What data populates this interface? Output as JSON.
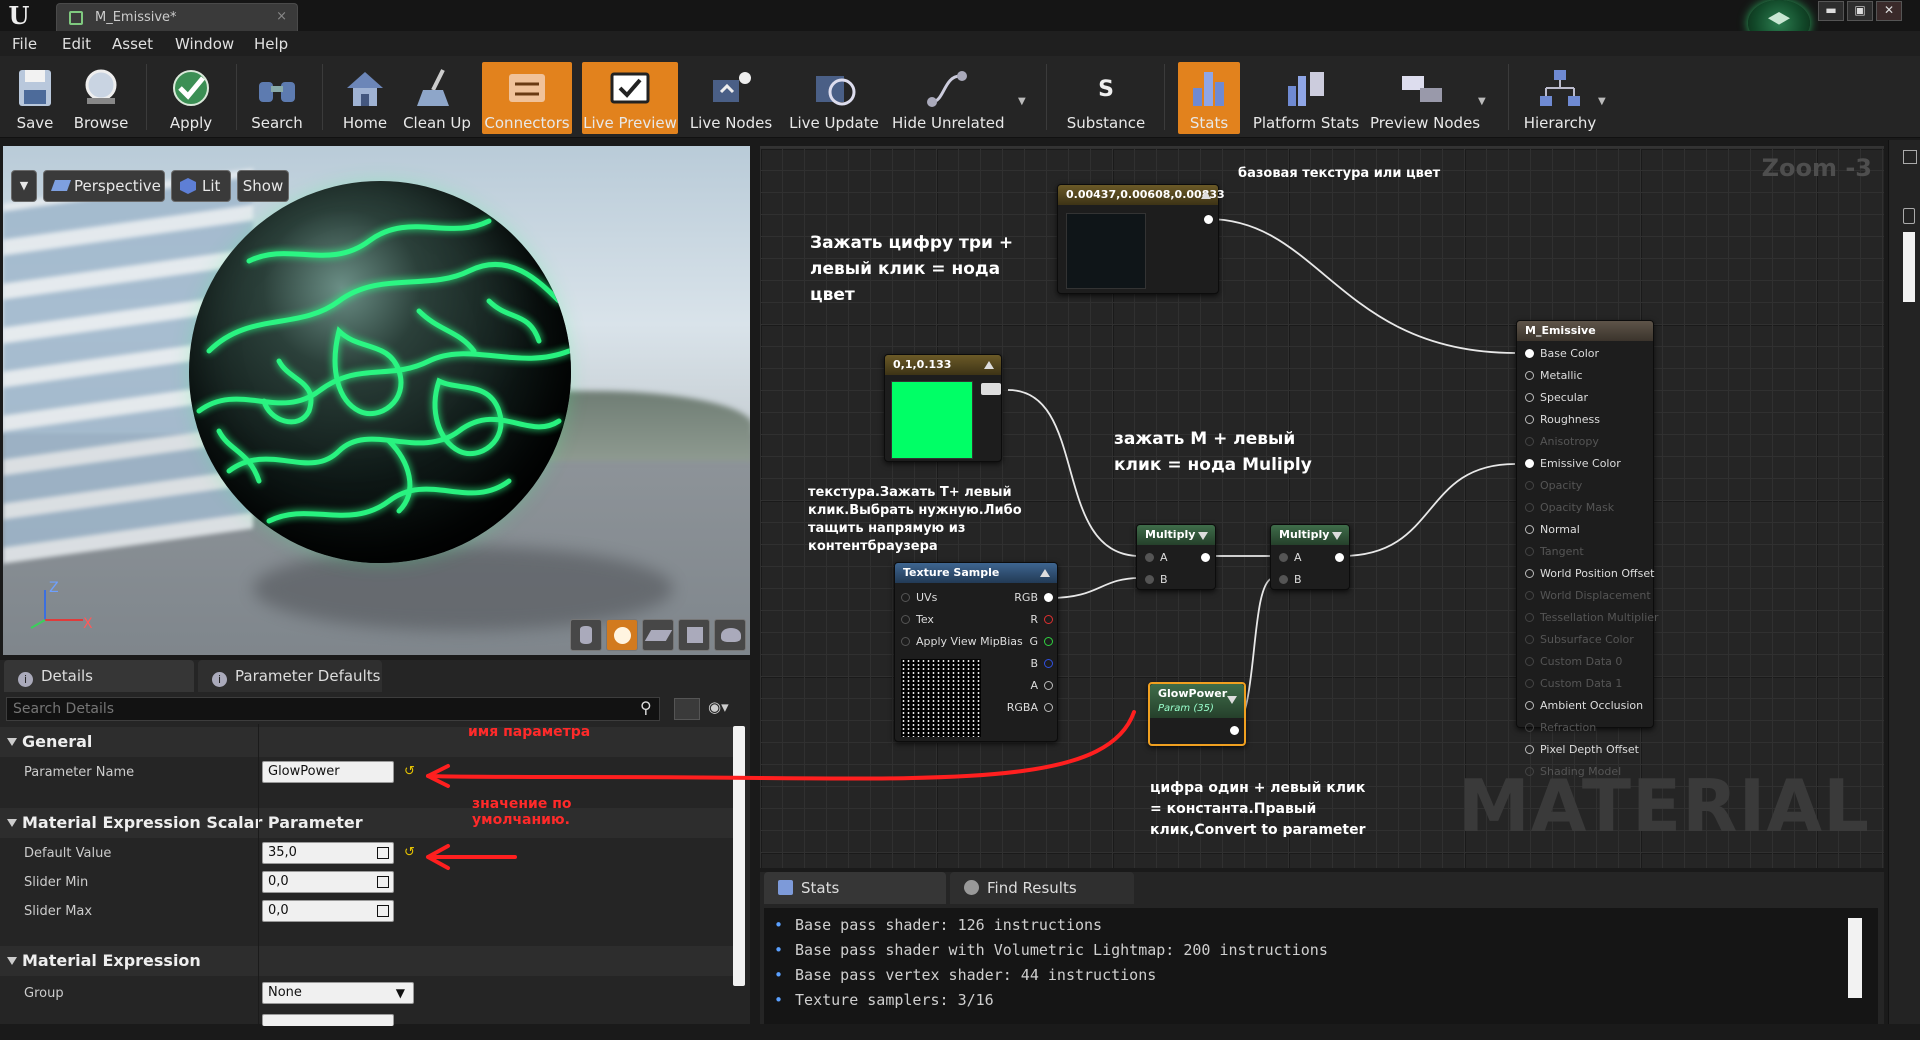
{
  "window": {
    "tab_title": "M_Emissive*",
    "tab_close": "×",
    "minimize": "▬",
    "restore": "▣",
    "close": "✕"
  },
  "menu": [
    "File",
    "Edit",
    "Asset",
    "Window",
    "Help"
  ],
  "toolbar": [
    {
      "label": "Save",
      "icon": "save-icon",
      "active": false
    },
    {
      "label": "Browse",
      "icon": "browse-icon",
      "active": false
    },
    {
      "label": "Apply",
      "icon": "apply-icon",
      "active": false
    },
    {
      "label": "Search",
      "icon": "search-icon",
      "active": false
    },
    {
      "label": "Home",
      "icon": "home-icon",
      "active": false
    },
    {
      "label": "Clean Up",
      "icon": "clean-up-icon",
      "active": false
    },
    {
      "label": "Connectors",
      "icon": "connectors-icon",
      "active": true
    },
    {
      "label": "Live Preview",
      "icon": "live-preview-icon",
      "active": true
    },
    {
      "label": "Live Nodes",
      "icon": "live-nodes-icon",
      "active": false
    },
    {
      "label": "Live Update",
      "icon": "live-update-icon",
      "active": false
    },
    {
      "label": "Hide Unrelated",
      "icon": "hide-unrelated-icon",
      "active": false
    },
    {
      "label": "Substance",
      "icon": "substance-icon",
      "active": false
    },
    {
      "label": "Stats",
      "icon": "stats-icon",
      "active": true
    },
    {
      "label": "Platform Stats",
      "icon": "platform-stats-icon",
      "active": false
    },
    {
      "label": "Preview Nodes",
      "icon": "preview-nodes-icon",
      "active": false
    },
    {
      "label": "Hierarchy",
      "icon": "hierarchy-icon",
      "active": false
    }
  ],
  "viewport": {
    "perspective": "Perspective",
    "lit": "Lit",
    "show": "Show",
    "axis_z": "Z",
    "axis_x": "X",
    "glow_color": "#2bff86"
  },
  "details": {
    "tabs": [
      "Details",
      "Parameter Defaults"
    ],
    "search_placeholder": "Search Details",
    "sections": {
      "general": "General",
      "scalar": "Material Expression Scalar Parameter",
      "expression": "Material Expression"
    },
    "parameter_name_label": "Parameter Name",
    "parameter_name_value": "GlowPower",
    "default_value_label": "Default Value",
    "default_value": "35,0",
    "slider_min_label": "Slider Min",
    "slider_min": "0,0",
    "slider_max_label": "Slider Max",
    "slider_max": "0,0",
    "group_label": "Group",
    "group_value": "None",
    "red_note_name": "имя параметра",
    "red_note_default": "значение по\nумолчанию."
  },
  "graph": {
    "zoom": "Zoom -3",
    "watermark": "MATERIAL",
    "annotations": {
      "base_texture": "базовая текстура или цвет",
      "three_click": "Зажать цифру три +\nлевый клик = нода\nцвет",
      "m_click": "зажать M + левый\nклик = нода Muliply",
      "texture": "текстура.Зажать Т+ левый\nклик.Выбрать нужную.Либо\nтащить напрямую из\nконтентбраузера",
      "one_click": "цифра один + левый клик\n= константа.Правый\nклик,Convert to parameter"
    },
    "nodes": {
      "const3": {
        "title": "0.00437,0.00608,0.00833",
        "swatch": "#0f1518"
      },
      "color2": {
        "title": "0,1,0.133",
        "swatch": "#00ff44"
      },
      "multiply1": {
        "title": "Multiply",
        "a": "A",
        "b": "B"
      },
      "multiply2": {
        "title": "Multiply",
        "a": "A",
        "b": "B"
      },
      "texture": {
        "title": "Texture Sample",
        "inputs": [
          "UVs",
          "Tex",
          "Apply View MipBias"
        ],
        "outputs": [
          "RGB",
          "R",
          "G",
          "B",
          "A",
          "RGBA"
        ]
      },
      "glow": {
        "title": "GlowPower",
        "subtitle": "Param (35)"
      },
      "material": {
        "title": "M_Emissive",
        "pins": [
          {
            "label": "Base Color",
            "enabled": true,
            "connected": true
          },
          {
            "label": "Metallic",
            "enabled": true,
            "connected": false
          },
          {
            "label": "Specular",
            "enabled": true,
            "connected": false
          },
          {
            "label": "Roughness",
            "enabled": true,
            "connected": false
          },
          {
            "label": "Anisotropy",
            "enabled": false,
            "connected": false
          },
          {
            "label": "Emissive Color",
            "enabled": true,
            "connected": true
          },
          {
            "label": "Opacity",
            "enabled": false,
            "connected": false
          },
          {
            "label": "Opacity Mask",
            "enabled": false,
            "connected": false
          },
          {
            "label": "Normal",
            "enabled": true,
            "connected": false
          },
          {
            "label": "Tangent",
            "enabled": false,
            "connected": false
          },
          {
            "label": "World Position Offset",
            "enabled": true,
            "connected": false
          },
          {
            "label": "World Displacement",
            "enabled": false,
            "connected": false
          },
          {
            "label": "Tessellation Multiplier",
            "enabled": false,
            "connected": false
          },
          {
            "label": "Subsurface Color",
            "enabled": false,
            "connected": false
          },
          {
            "label": "Custom Data 0",
            "enabled": false,
            "connected": false
          },
          {
            "label": "Custom Data 1",
            "enabled": false,
            "connected": false
          },
          {
            "label": "Ambient Occlusion",
            "enabled": true,
            "connected": false
          },
          {
            "label": "Refraction",
            "enabled": false,
            "connected": false
          },
          {
            "label": "Pixel Depth Offset",
            "enabled": true,
            "connected": false
          },
          {
            "label": "Shading Model",
            "enabled": false,
            "connected": false
          }
        ]
      }
    }
  },
  "stats": {
    "tabs": [
      "Stats",
      "Find Results"
    ],
    "lines": [
      "Base pass shader: 126 instructions",
      "Base pass shader with Volumetric Lightmap: 200 instructions",
      "Base pass vertex shader: 44 instructions",
      "Texture samplers: 3/16"
    ]
  }
}
